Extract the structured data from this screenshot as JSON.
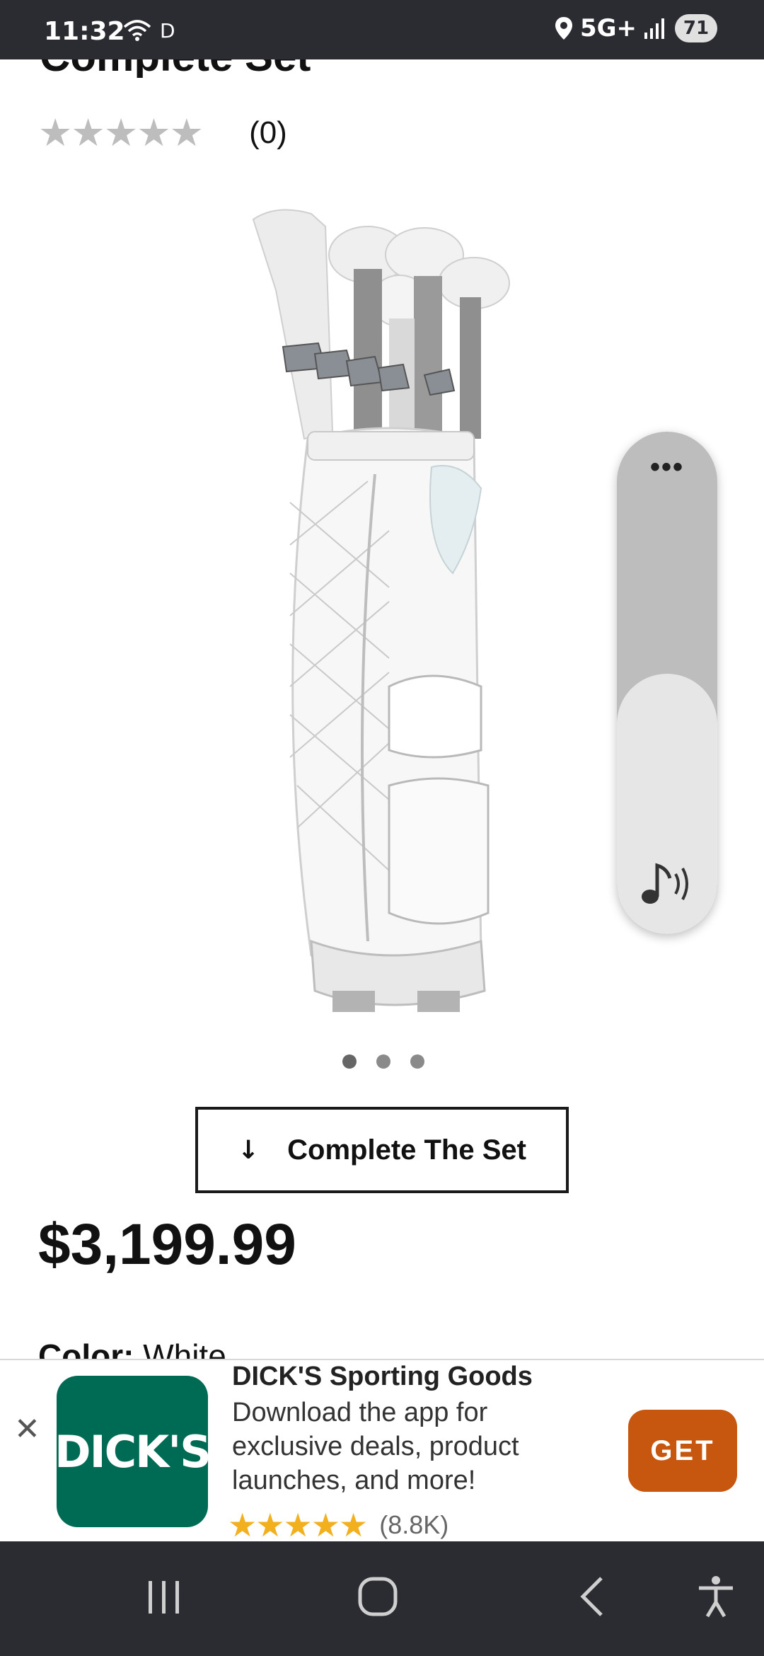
{
  "status_bar": {
    "time": "11:32",
    "indicator_d": "D",
    "network": "5G+",
    "battery": "71"
  },
  "product": {
    "title_partial": "Complete Set",
    "rating_count": "(0)",
    "complete_set_label": "Complete The Set",
    "price": "$3,199.99",
    "color_label": "Color:",
    "color_value": "White",
    "carousel_total": 3,
    "carousel_active": 1
  },
  "app_banner": {
    "app_name": "DICK'S Sporting Goods",
    "description": "Download the app for exclusive deals, product launches, and more!",
    "logo_text": "DICK'S",
    "rating_count": "(8.8K)",
    "get_label": "GET",
    "logo_color": "#006b54",
    "get_color": "#c7570e"
  },
  "music_widget": {
    "icons": [
      "more-icon",
      "music-note-sound-icon"
    ]
  },
  "nav_bar": {
    "icons": [
      "recent-apps-icon",
      "home-icon",
      "back-icon",
      "accessibility-icon"
    ]
  }
}
